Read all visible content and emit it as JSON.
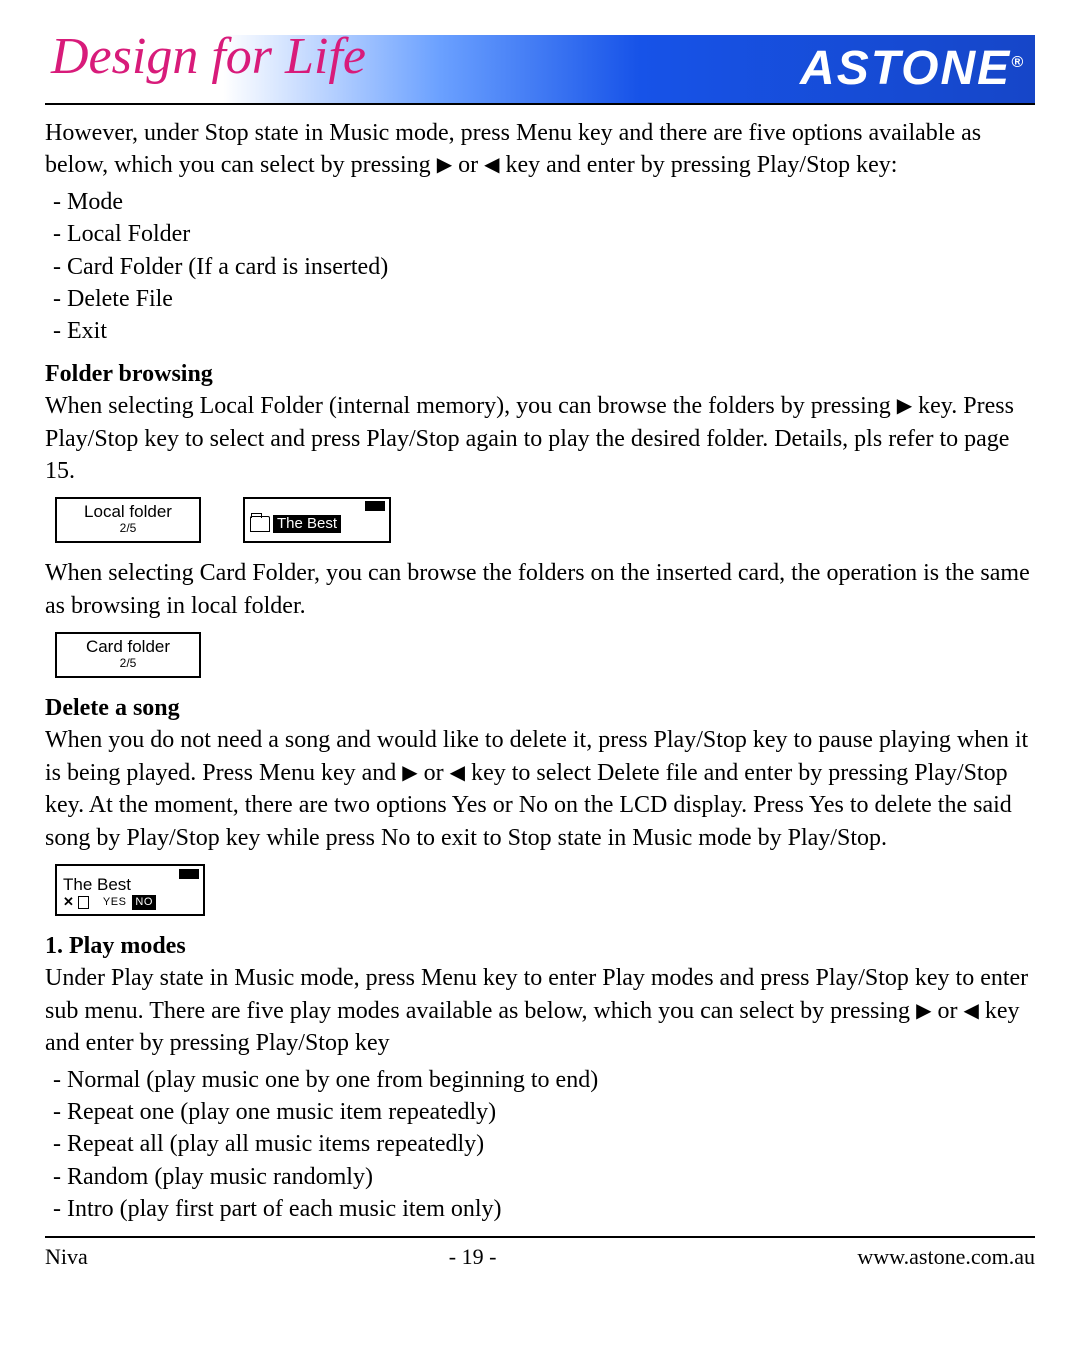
{
  "header": {
    "tagline": "Design for Life",
    "brand": "ASTONE",
    "brand_tm": "®"
  },
  "intro": {
    "p1a": "However, under Stop state in Music mode, press Menu key and there are five options available as below, which you can select by pressing ",
    "p1b": " or ",
    "p1c": " key and enter by pressing Play/Stop key:"
  },
  "options": [
    "- Mode",
    "- Local Folder",
    "- Card Folder (If a card is inserted)",
    "- Delete File",
    "- Exit"
  ],
  "folder": {
    "title": "Folder browsing",
    "p1a": "When selecting Local Folder (internal memory), you can browse the folders by pressing ",
    "p1b": " key. Press Play/Stop key to select and press Play/Stop again to play the desired folder. Details, pls refer to page 15.",
    "p2": "When selecting Card Folder, you can browse the folders on the inserted card, the operation is the same as browsing in local folder."
  },
  "lcd": {
    "local": {
      "line1": "Local folder",
      "line2": "2/5"
    },
    "best": {
      "label": "The Best"
    },
    "card": {
      "line1": "Card folder",
      "line2": "2/5"
    },
    "delete": {
      "title": "The Best",
      "yes": "YES",
      "no": "NO"
    }
  },
  "delete": {
    "title": "Delete a song",
    "p1a": "When you do not need a song and would like to delete it, press Play/Stop key to pause playing when it is being played. Press Menu key and ",
    "p1b": " or ",
    "p1c": " key to select Delete file and enter by pressing Play/Stop key. At the moment, there are two options Yes or No on the LCD display. Press Yes to delete the said song by Play/Stop key while press No to exit to Stop state in Music mode by Play/Stop."
  },
  "playmodes": {
    "title": "1. Play modes",
    "p1a": "Under Play state in Music mode, press Menu key to enter Play modes and press Play/Stop key to enter sub menu. There are five play modes available as below, which you can select by pressing ",
    "p1b": " or ",
    "p1c": " key and enter by pressing Play/Stop key",
    "items": [
      "- Normal (play music one by one from beginning to end)",
      "- Repeat one (play one music item repeatedly)",
      "- Repeat all (play all music items repeatedly)",
      "- Random (play music randomly)",
      "- Intro (play first part of each music item only)"
    ]
  },
  "footer": {
    "left": "Niva",
    "center": "- 19 -",
    "right": "www.astone.com.au"
  },
  "glyphs": {
    "right": "▶",
    "left": "◀"
  }
}
